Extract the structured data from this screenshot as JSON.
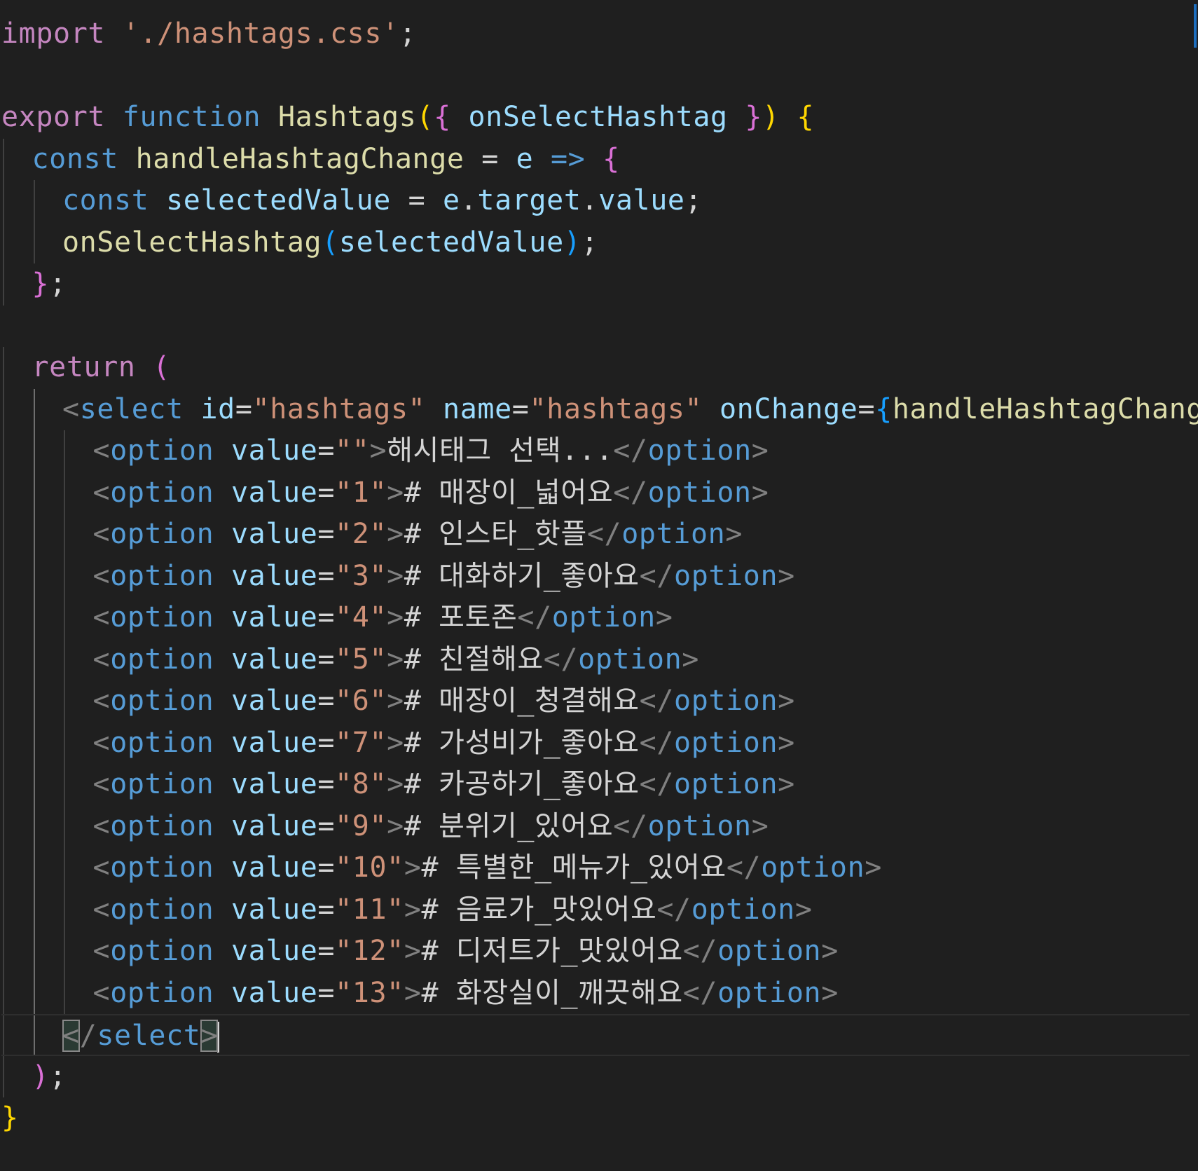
{
  "editor": {
    "language": "javascriptreact",
    "lines": [
      {
        "indent": 0,
        "tokens": [
          {
            "c": "kw",
            "t": "import"
          },
          {
            "c": "txt",
            "t": " "
          },
          {
            "c": "str",
            "t": "'./hashtags.css'"
          },
          {
            "c": "txt",
            "t": ";"
          }
        ]
      },
      {
        "indent": 0,
        "tokens": []
      },
      {
        "indent": 0,
        "tokens": [
          {
            "c": "kw",
            "t": "export"
          },
          {
            "c": "txt",
            "t": " "
          },
          {
            "c": "st",
            "t": "function"
          },
          {
            "c": "txt",
            "t": " "
          },
          {
            "c": "fn",
            "t": "Hashtags"
          },
          {
            "c": "p1",
            "t": "("
          },
          {
            "c": "p2",
            "t": "{"
          },
          {
            "c": "txt",
            "t": " "
          },
          {
            "c": "var",
            "t": "onSelectHashtag"
          },
          {
            "c": "txt",
            "t": " "
          },
          {
            "c": "p2",
            "t": "}"
          },
          {
            "c": "p1",
            "t": ")"
          },
          {
            "c": "txt",
            "t": " "
          },
          {
            "c": "p1",
            "t": "{"
          }
        ]
      },
      {
        "indent": 1,
        "tokens": [
          {
            "c": "st",
            "t": "const"
          },
          {
            "c": "txt",
            "t": " "
          },
          {
            "c": "fn",
            "t": "handleHashtagChange"
          },
          {
            "c": "txt",
            "t": " = "
          },
          {
            "c": "var",
            "t": "e"
          },
          {
            "c": "txt",
            "t": " "
          },
          {
            "c": "st",
            "t": "=>"
          },
          {
            "c": "txt",
            "t": " "
          },
          {
            "c": "p2",
            "t": "{"
          }
        ]
      },
      {
        "indent": 2,
        "tokens": [
          {
            "c": "st",
            "t": "const"
          },
          {
            "c": "txt",
            "t": " "
          },
          {
            "c": "var",
            "t": "selectedValue"
          },
          {
            "c": "txt",
            "t": " = "
          },
          {
            "c": "var",
            "t": "e"
          },
          {
            "c": "txt",
            "t": "."
          },
          {
            "c": "var",
            "t": "target"
          },
          {
            "c": "txt",
            "t": "."
          },
          {
            "c": "var",
            "t": "value"
          },
          {
            "c": "txt",
            "t": ";"
          }
        ]
      },
      {
        "indent": 2,
        "tokens": [
          {
            "c": "fn",
            "t": "onSelectHashtag"
          },
          {
            "c": "p3",
            "t": "("
          },
          {
            "c": "var",
            "t": "selectedValue"
          },
          {
            "c": "p3",
            "t": ")"
          },
          {
            "c": "txt",
            "t": ";"
          }
        ]
      },
      {
        "indent": 1,
        "tokens": [
          {
            "c": "p2",
            "t": "}"
          },
          {
            "c": "txt",
            "t": ";"
          }
        ]
      },
      {
        "indent": 0,
        "tokens": []
      },
      {
        "indent": 1,
        "tokens": [
          {
            "c": "kw",
            "t": "return"
          },
          {
            "c": "txt",
            "t": " "
          },
          {
            "c": "p2",
            "t": "("
          }
        ]
      },
      {
        "indent": 2,
        "tokens": [
          {
            "c": "tagp",
            "t": "<"
          },
          {
            "c": "tag",
            "t": "select"
          },
          {
            "c": "txt",
            "t": " "
          },
          {
            "c": "attr",
            "t": "id"
          },
          {
            "c": "txt",
            "t": "="
          },
          {
            "c": "str",
            "t": "\"hashtags\""
          },
          {
            "c": "txt",
            "t": " "
          },
          {
            "c": "attr",
            "t": "name"
          },
          {
            "c": "txt",
            "t": "="
          },
          {
            "c": "str",
            "t": "\"hashtags\""
          },
          {
            "c": "txt",
            "t": " "
          },
          {
            "c": "attr",
            "t": "onChange"
          },
          {
            "c": "txt",
            "t": "="
          },
          {
            "c": "p3",
            "t": "{"
          },
          {
            "c": "fn",
            "t": "handleHashtagChange"
          },
          {
            "c": "p3",
            "t": "}"
          }
        ]
      },
      {
        "indent": 3,
        "tokens": [
          {
            "c": "tagp",
            "t": "<"
          },
          {
            "c": "tag",
            "t": "option"
          },
          {
            "c": "txt",
            "t": " "
          },
          {
            "c": "attr",
            "t": "value"
          },
          {
            "c": "txt",
            "t": "="
          },
          {
            "c": "str",
            "t": "\"\""
          },
          {
            "c": "tagp",
            "t": ">"
          },
          {
            "c": "txt",
            "t": "해시태그 선택..."
          },
          {
            "c": "tagp",
            "t": "</"
          },
          {
            "c": "tag",
            "t": "option"
          },
          {
            "c": "tagp",
            "t": ">"
          }
        ]
      },
      {
        "indent": 3,
        "tokens": [
          {
            "c": "tagp",
            "t": "<"
          },
          {
            "c": "tag",
            "t": "option"
          },
          {
            "c": "txt",
            "t": " "
          },
          {
            "c": "attr",
            "t": "value"
          },
          {
            "c": "txt",
            "t": "="
          },
          {
            "c": "str",
            "t": "\"1\""
          },
          {
            "c": "tagp",
            "t": ">"
          },
          {
            "c": "txt",
            "t": "# 매장이_넓어요"
          },
          {
            "c": "tagp",
            "t": "</"
          },
          {
            "c": "tag",
            "t": "option"
          },
          {
            "c": "tagp",
            "t": ">"
          }
        ]
      },
      {
        "indent": 3,
        "tokens": [
          {
            "c": "tagp",
            "t": "<"
          },
          {
            "c": "tag",
            "t": "option"
          },
          {
            "c": "txt",
            "t": " "
          },
          {
            "c": "attr",
            "t": "value"
          },
          {
            "c": "txt",
            "t": "="
          },
          {
            "c": "str",
            "t": "\"2\""
          },
          {
            "c": "tagp",
            "t": ">"
          },
          {
            "c": "txt",
            "t": "# 인스타_핫플"
          },
          {
            "c": "tagp",
            "t": "</"
          },
          {
            "c": "tag",
            "t": "option"
          },
          {
            "c": "tagp",
            "t": ">"
          }
        ]
      },
      {
        "indent": 3,
        "tokens": [
          {
            "c": "tagp",
            "t": "<"
          },
          {
            "c": "tag",
            "t": "option"
          },
          {
            "c": "txt",
            "t": " "
          },
          {
            "c": "attr",
            "t": "value"
          },
          {
            "c": "txt",
            "t": "="
          },
          {
            "c": "str",
            "t": "\"3\""
          },
          {
            "c": "tagp",
            "t": ">"
          },
          {
            "c": "txt",
            "t": "# 대화하기_좋아요"
          },
          {
            "c": "tagp",
            "t": "</"
          },
          {
            "c": "tag",
            "t": "option"
          },
          {
            "c": "tagp",
            "t": ">"
          }
        ]
      },
      {
        "indent": 3,
        "tokens": [
          {
            "c": "tagp",
            "t": "<"
          },
          {
            "c": "tag",
            "t": "option"
          },
          {
            "c": "txt",
            "t": " "
          },
          {
            "c": "attr",
            "t": "value"
          },
          {
            "c": "txt",
            "t": "="
          },
          {
            "c": "str",
            "t": "\"4\""
          },
          {
            "c": "tagp",
            "t": ">"
          },
          {
            "c": "txt",
            "t": "# 포토존"
          },
          {
            "c": "tagp",
            "t": "</"
          },
          {
            "c": "tag",
            "t": "option"
          },
          {
            "c": "tagp",
            "t": ">"
          }
        ]
      },
      {
        "indent": 3,
        "tokens": [
          {
            "c": "tagp",
            "t": "<"
          },
          {
            "c": "tag",
            "t": "option"
          },
          {
            "c": "txt",
            "t": " "
          },
          {
            "c": "attr",
            "t": "value"
          },
          {
            "c": "txt",
            "t": "="
          },
          {
            "c": "str",
            "t": "\"5\""
          },
          {
            "c": "tagp",
            "t": ">"
          },
          {
            "c": "txt",
            "t": "# 친절해요"
          },
          {
            "c": "tagp",
            "t": "</"
          },
          {
            "c": "tag",
            "t": "option"
          },
          {
            "c": "tagp",
            "t": ">"
          }
        ]
      },
      {
        "indent": 3,
        "tokens": [
          {
            "c": "tagp",
            "t": "<"
          },
          {
            "c": "tag",
            "t": "option"
          },
          {
            "c": "txt",
            "t": " "
          },
          {
            "c": "attr",
            "t": "value"
          },
          {
            "c": "txt",
            "t": "="
          },
          {
            "c": "str",
            "t": "\"6\""
          },
          {
            "c": "tagp",
            "t": ">"
          },
          {
            "c": "txt",
            "t": "# 매장이_청결해요"
          },
          {
            "c": "tagp",
            "t": "</"
          },
          {
            "c": "tag",
            "t": "option"
          },
          {
            "c": "tagp",
            "t": ">"
          }
        ]
      },
      {
        "indent": 3,
        "tokens": [
          {
            "c": "tagp",
            "t": "<"
          },
          {
            "c": "tag",
            "t": "option"
          },
          {
            "c": "txt",
            "t": " "
          },
          {
            "c": "attr",
            "t": "value"
          },
          {
            "c": "txt",
            "t": "="
          },
          {
            "c": "str",
            "t": "\"7\""
          },
          {
            "c": "tagp",
            "t": ">"
          },
          {
            "c": "txt",
            "t": "# 가성비가_좋아요"
          },
          {
            "c": "tagp",
            "t": "</"
          },
          {
            "c": "tag",
            "t": "option"
          },
          {
            "c": "tagp",
            "t": ">"
          }
        ]
      },
      {
        "indent": 3,
        "tokens": [
          {
            "c": "tagp",
            "t": "<"
          },
          {
            "c": "tag",
            "t": "option"
          },
          {
            "c": "txt",
            "t": " "
          },
          {
            "c": "attr",
            "t": "value"
          },
          {
            "c": "txt",
            "t": "="
          },
          {
            "c": "str",
            "t": "\"8\""
          },
          {
            "c": "tagp",
            "t": ">"
          },
          {
            "c": "txt",
            "t": "# 카공하기_좋아요"
          },
          {
            "c": "tagp",
            "t": "</"
          },
          {
            "c": "tag",
            "t": "option"
          },
          {
            "c": "tagp",
            "t": ">"
          }
        ]
      },
      {
        "indent": 3,
        "tokens": [
          {
            "c": "tagp",
            "t": "<"
          },
          {
            "c": "tag",
            "t": "option"
          },
          {
            "c": "txt",
            "t": " "
          },
          {
            "c": "attr",
            "t": "value"
          },
          {
            "c": "txt",
            "t": "="
          },
          {
            "c": "str",
            "t": "\"9\""
          },
          {
            "c": "tagp",
            "t": ">"
          },
          {
            "c": "txt",
            "t": "# 분위기_있어요"
          },
          {
            "c": "tagp",
            "t": "</"
          },
          {
            "c": "tag",
            "t": "option"
          },
          {
            "c": "tagp",
            "t": ">"
          }
        ]
      },
      {
        "indent": 3,
        "tokens": [
          {
            "c": "tagp",
            "t": "<"
          },
          {
            "c": "tag",
            "t": "option"
          },
          {
            "c": "txt",
            "t": " "
          },
          {
            "c": "attr",
            "t": "value"
          },
          {
            "c": "txt",
            "t": "="
          },
          {
            "c": "str",
            "t": "\"10\""
          },
          {
            "c": "tagp",
            "t": ">"
          },
          {
            "c": "txt",
            "t": "# 특별한_메뉴가_있어요"
          },
          {
            "c": "tagp",
            "t": "</"
          },
          {
            "c": "tag",
            "t": "option"
          },
          {
            "c": "tagp",
            "t": ">"
          }
        ]
      },
      {
        "indent": 3,
        "tokens": [
          {
            "c": "tagp",
            "t": "<"
          },
          {
            "c": "tag",
            "t": "option"
          },
          {
            "c": "txt",
            "t": " "
          },
          {
            "c": "attr",
            "t": "value"
          },
          {
            "c": "txt",
            "t": "="
          },
          {
            "c": "str",
            "t": "\"11\""
          },
          {
            "c": "tagp",
            "t": ">"
          },
          {
            "c": "txt",
            "t": "# 음료가_맛있어요"
          },
          {
            "c": "tagp",
            "t": "</"
          },
          {
            "c": "tag",
            "t": "option"
          },
          {
            "c": "tagp",
            "t": ">"
          }
        ]
      },
      {
        "indent": 3,
        "tokens": [
          {
            "c": "tagp",
            "t": "<"
          },
          {
            "c": "tag",
            "t": "option"
          },
          {
            "c": "txt",
            "t": " "
          },
          {
            "c": "attr",
            "t": "value"
          },
          {
            "c": "txt",
            "t": "="
          },
          {
            "c": "str",
            "t": "\"12\""
          },
          {
            "c": "tagp",
            "t": ">"
          },
          {
            "c": "txt",
            "t": "# 디저트가_맛있어요"
          },
          {
            "c": "tagp",
            "t": "</"
          },
          {
            "c": "tag",
            "t": "option"
          },
          {
            "c": "tagp",
            "t": ">"
          }
        ]
      },
      {
        "indent": 3,
        "tokens": [
          {
            "c": "tagp",
            "t": "<"
          },
          {
            "c": "tag",
            "t": "option"
          },
          {
            "c": "txt",
            "t": " "
          },
          {
            "c": "attr",
            "t": "value"
          },
          {
            "c": "txt",
            "t": "="
          },
          {
            "c": "str",
            "t": "\"13\""
          },
          {
            "c": "tagp",
            "t": ">"
          },
          {
            "c": "txt",
            "t": "# 화장실이_깨끗해요"
          },
          {
            "c": "tagp",
            "t": "</"
          },
          {
            "c": "tag",
            "t": "option"
          },
          {
            "c": "tagp",
            "t": ">"
          }
        ]
      },
      {
        "indent": 2,
        "current": true,
        "tokens": [
          {
            "c": "tagp bm",
            "t": "<"
          },
          {
            "c": "tagp",
            "t": "/"
          },
          {
            "c": "tag",
            "t": "select"
          },
          {
            "c": "tagp bm",
            "t": ">"
          }
        ]
      },
      {
        "indent": 1,
        "tokens": [
          {
            "c": "p2",
            "t": ")"
          },
          {
            "c": "txt",
            "t": ";"
          }
        ]
      },
      {
        "indent": 0,
        "tokens": [
          {
            "c": "p1",
            "t": "}"
          }
        ]
      }
    ]
  }
}
